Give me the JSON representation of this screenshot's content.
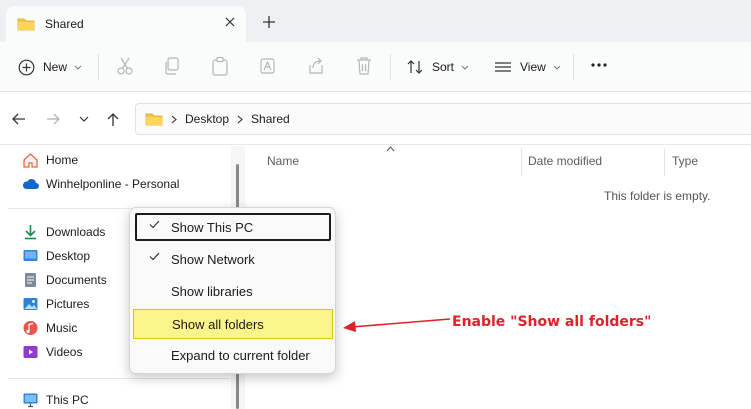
{
  "window": {
    "tab_title": "Shared"
  },
  "commandbar": {
    "new_label": "New",
    "sort_label": "Sort",
    "view_label": "View"
  },
  "address": {
    "crumbs": [
      "Desktop",
      "Shared"
    ]
  },
  "navpane": {
    "items": [
      {
        "label": "Home",
        "icon": "home-icon"
      },
      {
        "label": "Winhelponline - Personal",
        "icon": "onedrive-cloud-icon"
      },
      {
        "label": "Downloads",
        "icon": "downloads-icon"
      },
      {
        "label": "Desktop",
        "icon": "desktop-icon"
      },
      {
        "label": "Documents",
        "icon": "documents-icon"
      },
      {
        "label": "Pictures",
        "icon": "pictures-icon"
      },
      {
        "label": "Music",
        "icon": "music-icon"
      },
      {
        "label": "Videos",
        "icon": "videos-icon"
      },
      {
        "label": "This PC",
        "icon": "this-pc-icon"
      }
    ]
  },
  "content": {
    "columns": [
      "Name",
      "Date modified",
      "Type"
    ],
    "empty_text": "This folder is empty."
  },
  "context_menu": {
    "items": [
      {
        "label": "Show This PC",
        "checked": true
      },
      {
        "label": "Show Network",
        "checked": true
      },
      {
        "label": "Show libraries",
        "checked": false
      },
      {
        "label": "Show all folders",
        "checked": false
      },
      {
        "label": "Expand to current folder",
        "checked": false
      }
    ]
  },
  "annotation": {
    "text": "Enable \"Show all folders\"",
    "color": "#e0202a"
  },
  "colors": {
    "highlight": "#faf58a",
    "folder": "#f4c542",
    "accent": "#0067c0"
  }
}
